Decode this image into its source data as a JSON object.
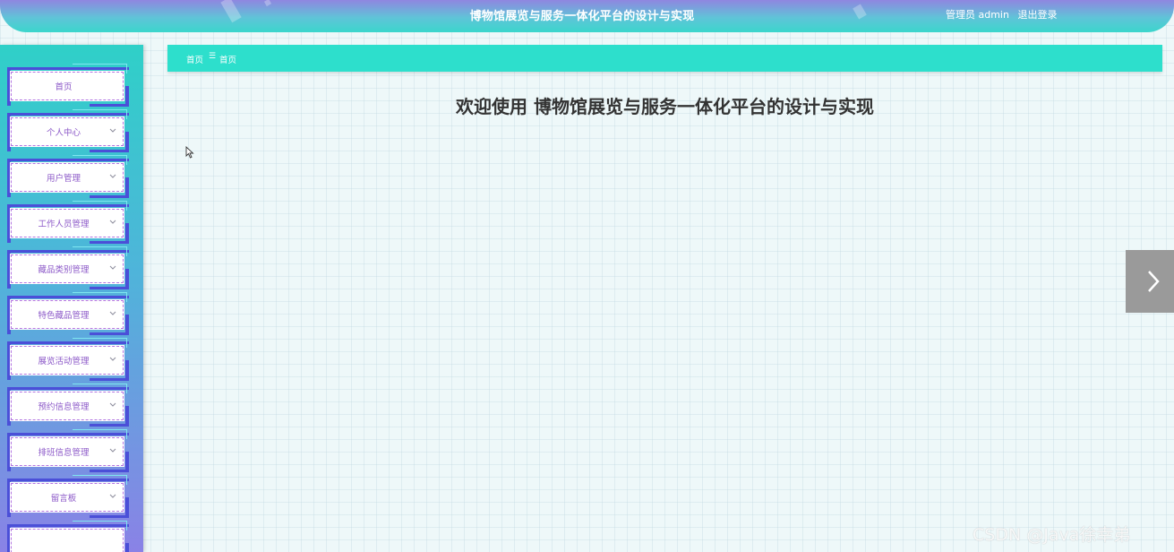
{
  "header": {
    "title": "博物馆展览与服务一体化平台的设计与实现",
    "user_role": "管理员 admin",
    "logout_label": "退出登录"
  },
  "sidebar": {
    "items": [
      {
        "label": "首页",
        "has_submenu": false
      },
      {
        "label": "个人中心",
        "has_submenu": true
      },
      {
        "label": "用户管理",
        "has_submenu": true
      },
      {
        "label": "工作人员管理",
        "has_submenu": true
      },
      {
        "label": "藏品类别管理",
        "has_submenu": true
      },
      {
        "label": "特色藏品管理",
        "has_submenu": true
      },
      {
        "label": "展览活动管理",
        "has_submenu": true
      },
      {
        "label": "预约信息管理",
        "has_submenu": true
      },
      {
        "label": "排班信息管理",
        "has_submenu": true
      },
      {
        "label": "留言板",
        "has_submenu": true
      },
      {
        "label": "",
        "has_submenu": false
      }
    ]
  },
  "breadcrumb": {
    "items": [
      "首页",
      "首页"
    ],
    "separator": "☰"
  },
  "main": {
    "welcome": "欢迎使用 博物馆展览与服务一体化平台的设计与实现"
  },
  "watermark": "CSDN @Java徐幸弟",
  "colors": {
    "accent": "#2ddfcc",
    "sidebar_frame": "#4b4fd8",
    "menu_text": "#8c59c8"
  }
}
